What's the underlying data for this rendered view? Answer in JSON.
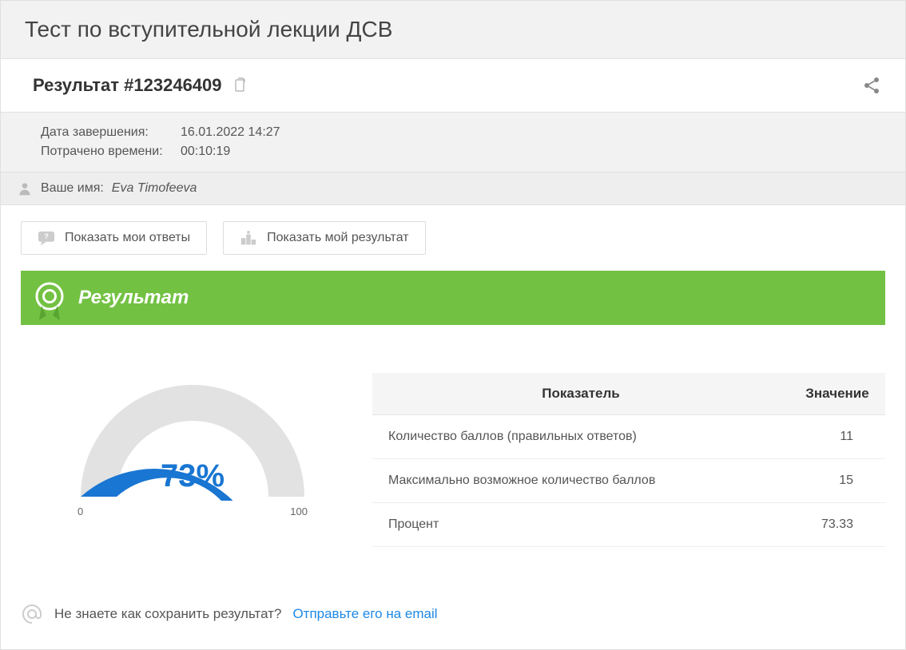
{
  "page": {
    "title": "Тест по вступительной лекции ДСВ"
  },
  "result_header": {
    "title": "Результат #123246409"
  },
  "meta": {
    "completed_label": "Дата завершения:",
    "completed_value": "16.01.2022 14:27",
    "time_spent_label": "Потрачено времени:",
    "time_spent_value": "00:10:19"
  },
  "name_block": {
    "label": "Ваше имя:",
    "value": "Eva Timofeeva"
  },
  "buttons": {
    "show_answers": "Показать мои ответы",
    "show_result": "Показать мой результат"
  },
  "banner": {
    "text": "Результат"
  },
  "gauge": {
    "display": "73%",
    "min": "0",
    "max": "100",
    "percent": 73
  },
  "metrics": {
    "header_metric": "Показатель",
    "header_value": "Значение",
    "rows": [
      {
        "label": "Количество баллов (правильных ответов)",
        "value": "11"
      },
      {
        "label": "Максимально возможное количество баллов",
        "value": "15"
      },
      {
        "label": "Процент",
        "value": "73.33"
      }
    ]
  },
  "footer": {
    "question": "Не знаете как сохранить результат?",
    "link_text": "Отправьте его на email"
  },
  "chart_data": {
    "type": "bar",
    "title": "Результат",
    "categories": [
      "percent"
    ],
    "values": [
      73.33
    ],
    "ylim": [
      0,
      100
    ],
    "xlabel": "",
    "ylabel": ""
  }
}
